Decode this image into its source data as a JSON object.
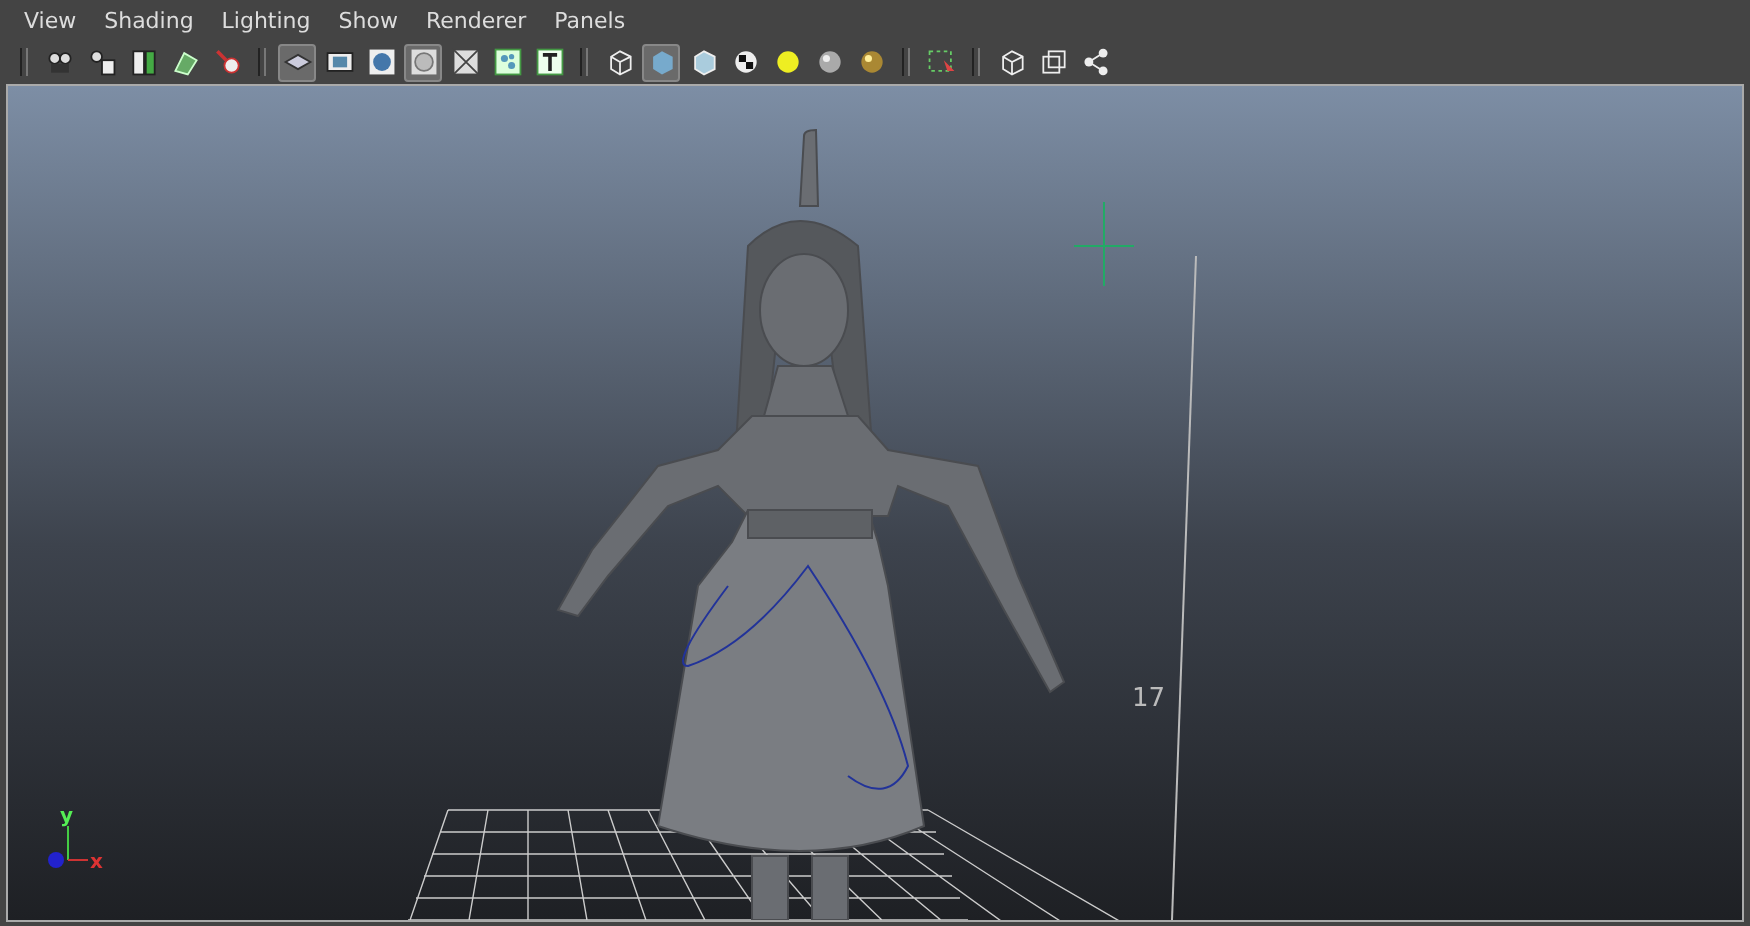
{
  "menu": [
    {
      "label": "View"
    },
    {
      "label": "Shading"
    },
    {
      "label": "Lighting"
    },
    {
      "label": "Show"
    },
    {
      "label": "Renderer"
    },
    {
      "label": "Panels"
    }
  ],
  "toolbar": [
    [
      {
        "kind": "camera",
        "selected": false
      },
      {
        "kind": "camera-attrs",
        "selected": false
      },
      {
        "kind": "bookmark",
        "selected": false
      },
      {
        "kind": "image-plane",
        "selected": false
      },
      {
        "kind": "zoom",
        "selected": false
      }
    ],
    [
      {
        "kind": "grid",
        "selected": true
      },
      {
        "kind": "film",
        "selected": false
      },
      {
        "kind": "sphere",
        "selected": false
      },
      {
        "kind": "circle",
        "selected": true
      },
      {
        "kind": "wire",
        "selected": false
      },
      {
        "kind": "dots",
        "selected": false
      },
      {
        "kind": "text",
        "selected": false
      }
    ],
    [
      {
        "kind": "cube-wire",
        "selected": false
      },
      {
        "kind": "cube-shaded",
        "selected": true
      },
      {
        "kind": "cube-tex",
        "selected": false
      },
      {
        "kind": "checker",
        "selected": false
      },
      {
        "kind": "light",
        "selected": false
      },
      {
        "kind": "ball",
        "selected": false
      },
      {
        "kind": "gold",
        "selected": false
      }
    ],
    [
      {
        "kind": "select",
        "selected": false
      }
    ],
    [
      {
        "kind": "cube-iso",
        "selected": false
      },
      {
        "kind": "frame",
        "selected": false
      },
      {
        "kind": "share",
        "selected": false
      }
    ]
  ],
  "viewport": {
    "distance_label": "17",
    "axis": {
      "y_label": "y",
      "x_label": "x"
    }
  }
}
